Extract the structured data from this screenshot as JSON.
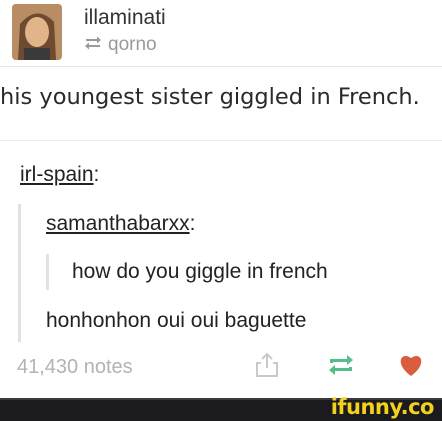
{
  "post": {
    "author": "illaminati",
    "reblogged_from": "qorno",
    "quote": "his youngest sister giggled in French.",
    "thread": {
      "user1": "irl-spain",
      "user2": "samanthabarxx",
      "message": "how do you giggle in french",
      "reply": "honhonhon oui oui baguette"
    },
    "notes": "41,430 notes"
  },
  "icons": {
    "avatar": "avatar-photo",
    "reblog_small": "reblog-icon",
    "share": "share-icon",
    "reblog": "reblog-icon",
    "like": "heart-icon"
  },
  "colors": {
    "reblog_green": "#56bc8a",
    "like_red": "#d95e40",
    "brand_yellow": "#f3d21a"
  },
  "footer": {
    "brand": "ifunny.co"
  }
}
